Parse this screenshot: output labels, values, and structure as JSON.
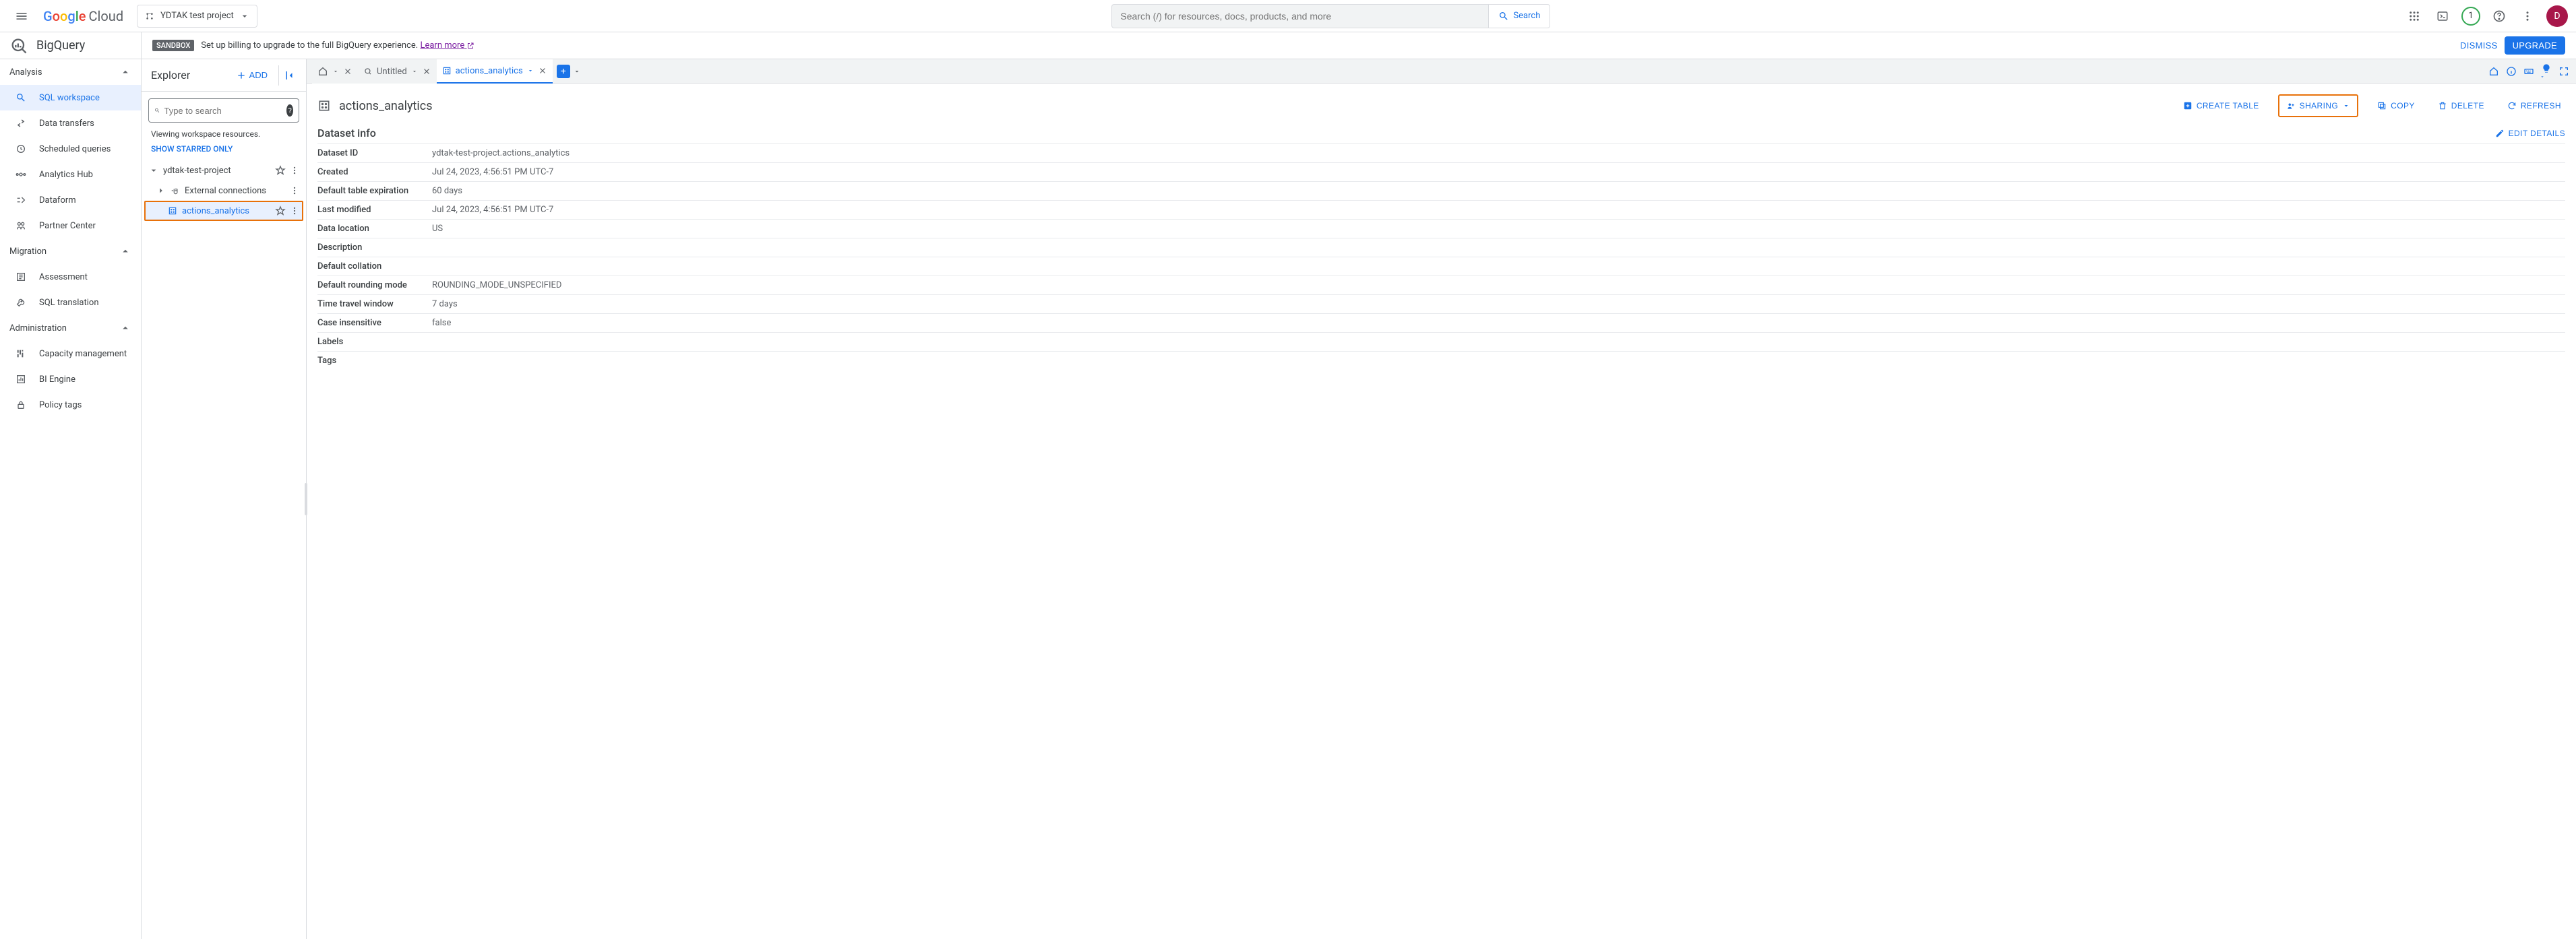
{
  "header": {
    "cloud_text": "Cloud",
    "project": "YDTAK test project",
    "search_placeholder": "Search (/) for resources, docs, products, and more",
    "search_btn": "Search",
    "badge_count": "1",
    "avatar_initial": "D"
  },
  "subheader": {
    "product": "BigQuery",
    "sandbox_chip": "SANDBOX",
    "sandbox_text": "Set up billing to upgrade to the full BigQuery experience. ",
    "learn_more": "Learn more",
    "dismiss": "DISMISS",
    "upgrade": "UPGRADE"
  },
  "sidebar": {
    "sections": {
      "analysis": {
        "title": "Analysis",
        "items": [
          "SQL workspace",
          "Data transfers",
          "Scheduled queries",
          "Analytics Hub",
          "Dataform",
          "Partner Center"
        ]
      },
      "migration": {
        "title": "Migration",
        "items": [
          "Assessment",
          "SQL translation"
        ]
      },
      "administration": {
        "title": "Administration",
        "items": [
          "Capacity management",
          "BI Engine",
          "Policy tags"
        ]
      }
    }
  },
  "explorer": {
    "title": "Explorer",
    "add": "ADD",
    "search_placeholder": "Type to search",
    "viewing_hint": "Viewing workspace resources.",
    "show_starred": "SHOW STARRED ONLY",
    "project_node": "ydtak-test-project",
    "external_conn": "External connections",
    "dataset_node": "actions_analytics"
  },
  "tabs": {
    "untitled": "Untitled",
    "active": "actions_analytics"
  },
  "content": {
    "title": "actions_analytics",
    "actions": {
      "create_table": "CREATE TABLE",
      "sharing": "SHARING",
      "copy": "COPY",
      "delete": "DELETE",
      "refresh": "REFRESH"
    },
    "section_title": "Dataset info",
    "edit_details": "EDIT DETAILS",
    "rows": [
      {
        "k": "Dataset ID",
        "v": "ydtak-test-project.actions_analytics"
      },
      {
        "k": "Created",
        "v": "Jul 24, 2023, 4:56:51 PM UTC-7"
      },
      {
        "k": "Default table expiration",
        "v": "60 days"
      },
      {
        "k": "Last modified",
        "v": "Jul 24, 2023, 4:56:51 PM UTC-7"
      },
      {
        "k": "Data location",
        "v": "US"
      },
      {
        "k": "Description",
        "v": ""
      },
      {
        "k": "Default collation",
        "v": ""
      },
      {
        "k": "Default rounding mode",
        "v": "ROUNDING_MODE_UNSPECIFIED"
      },
      {
        "k": "Time travel window",
        "v": "7 days"
      },
      {
        "k": "Case insensitive",
        "v": "false"
      },
      {
        "k": "Labels",
        "v": ""
      },
      {
        "k": "Tags",
        "v": ""
      }
    ]
  }
}
